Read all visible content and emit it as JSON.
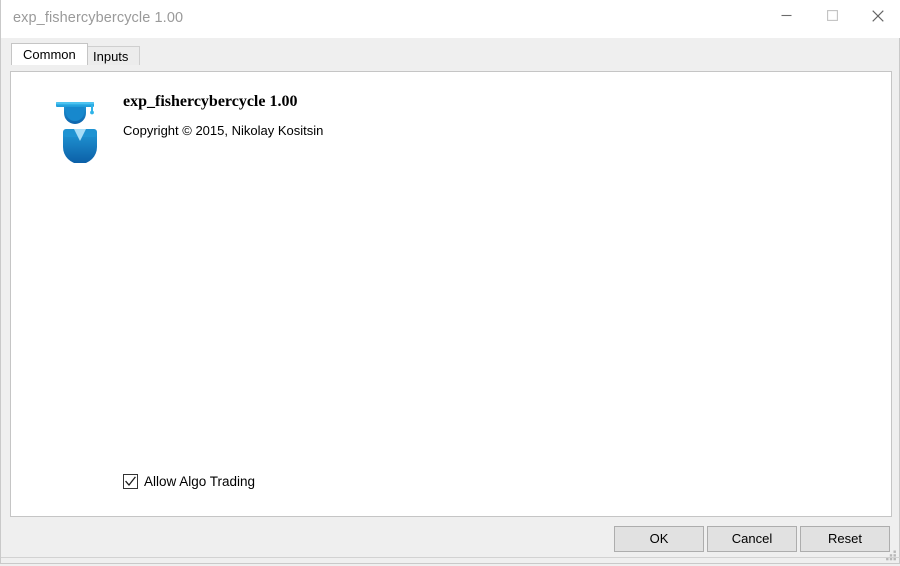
{
  "window": {
    "title": "exp_fishercybercycle 1.00",
    "caption_buttons": [
      {
        "name": "minimize",
        "label": "Minimize",
        "glyph": "minimize-icon"
      },
      {
        "name": "maximize",
        "label": "Maximize",
        "glyph": "maximize-icon"
      },
      {
        "name": "close",
        "label": "Close",
        "glyph": "close-icon"
      }
    ]
  },
  "tabs": [
    {
      "label": "Common",
      "active": true
    },
    {
      "label": "Inputs",
      "active": false
    }
  ],
  "expert": {
    "icon_name": "expert-advisor-icon",
    "name": "exp_fishercybercycle 1.00",
    "copyright": "Copyright © 2015, Nikolay Kositsin"
  },
  "options": {
    "allow_algo_trading": {
      "label": "Allow Algo Trading",
      "checked": true
    }
  },
  "footer": {
    "ok_label": "OK",
    "cancel_label": "Cancel",
    "reset_label": "Reset"
  },
  "colors": {
    "titlebar_bg": "#ffffff",
    "title_text": "#9a9a9a",
    "dialog_bg": "#efefef",
    "panel_bg": "#ffffff",
    "panel_border": "#c5c5c5",
    "tab_active_bg": "#ffffff",
    "tab_inactive_bg": "#ececec",
    "button_bg": "#e1e1e1",
    "button_border": "#adadad",
    "icon_cap_light": "#29abe2",
    "icon_cap_mid": "#1b8fd0",
    "icon_body_dark": "#0f6cb5",
    "icon_collar": "#9fd9f6"
  }
}
